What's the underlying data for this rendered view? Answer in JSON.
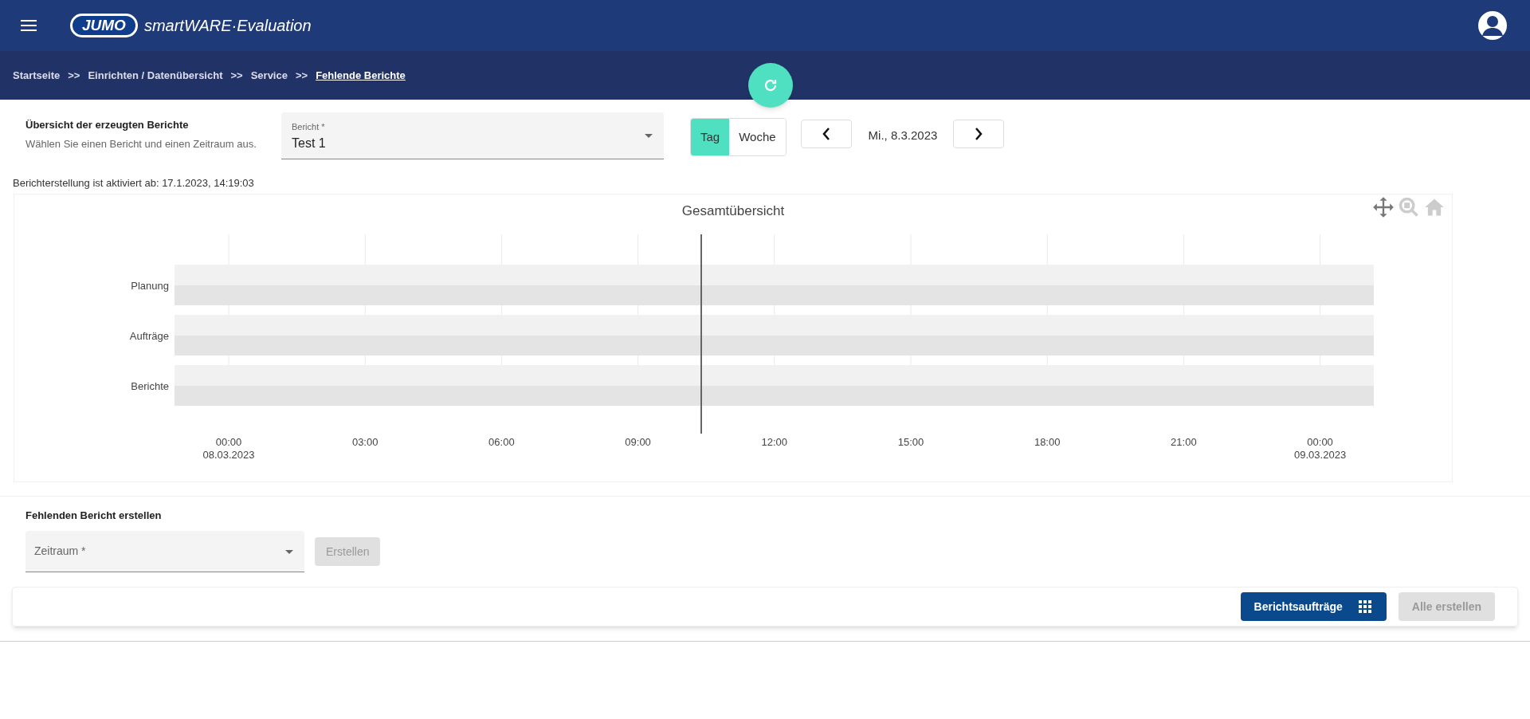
{
  "header": {
    "logo": "JUMO",
    "product": "smartWARE",
    "product_separator": "·",
    "product_suffix": "Evaluation"
  },
  "breadcrumb": [
    {
      "label": "Startseite",
      "selected": false
    },
    {
      "label": "Einrichten / Datenübersicht",
      "selected": false
    },
    {
      "label": "Service",
      "selected": false
    },
    {
      "label": "Fehlende Berichte",
      "selected": true
    }
  ],
  "breadcrumb_separator": ">>",
  "overview": {
    "title": "Übersicht der erzeugten Berichte",
    "subtitle": "Wählen Sie einen Bericht und einen Zeitraum aus.",
    "report_field": {
      "label": "Bericht *",
      "value": "Test 1"
    },
    "range_tabs": [
      {
        "label": "Tag",
        "selected": true
      },
      {
        "label": "Woche",
        "selected": false
      }
    ],
    "date": "Mi., 8.3.2023"
  },
  "status": "Berichterstellung ist aktiviert ab: 17.1.2023, 14:19:03",
  "chart": {
    "title": "Gesamtübersicht",
    "categories": [
      "Planung",
      "Aufträge",
      "Berichte"
    ],
    "xticks": [
      {
        "label": "00:00",
        "sublabel": "08.03.2023"
      },
      {
        "label": "03:00"
      },
      {
        "label": "06:00"
      },
      {
        "label": "09:00"
      },
      {
        "label": "12:00"
      },
      {
        "label": "15:00"
      },
      {
        "label": "18:00"
      },
      {
        "label": "21:00"
      },
      {
        "label": "00:00",
        "sublabel": "09.03.2023"
      }
    ]
  },
  "create": {
    "title": "Fehlenden Bericht erstellen",
    "period_field": {
      "placeholder": "Zeitraum *"
    },
    "button": {
      "label": "Erstellen",
      "disabled": true
    }
  },
  "footer": {
    "buttons": [
      {
        "label": "Berichtsaufträge",
        "kind": "primary",
        "disabled": false
      },
      {
        "label": "Alle erstellen",
        "kind": "plain",
        "disabled": true
      }
    ]
  }
}
